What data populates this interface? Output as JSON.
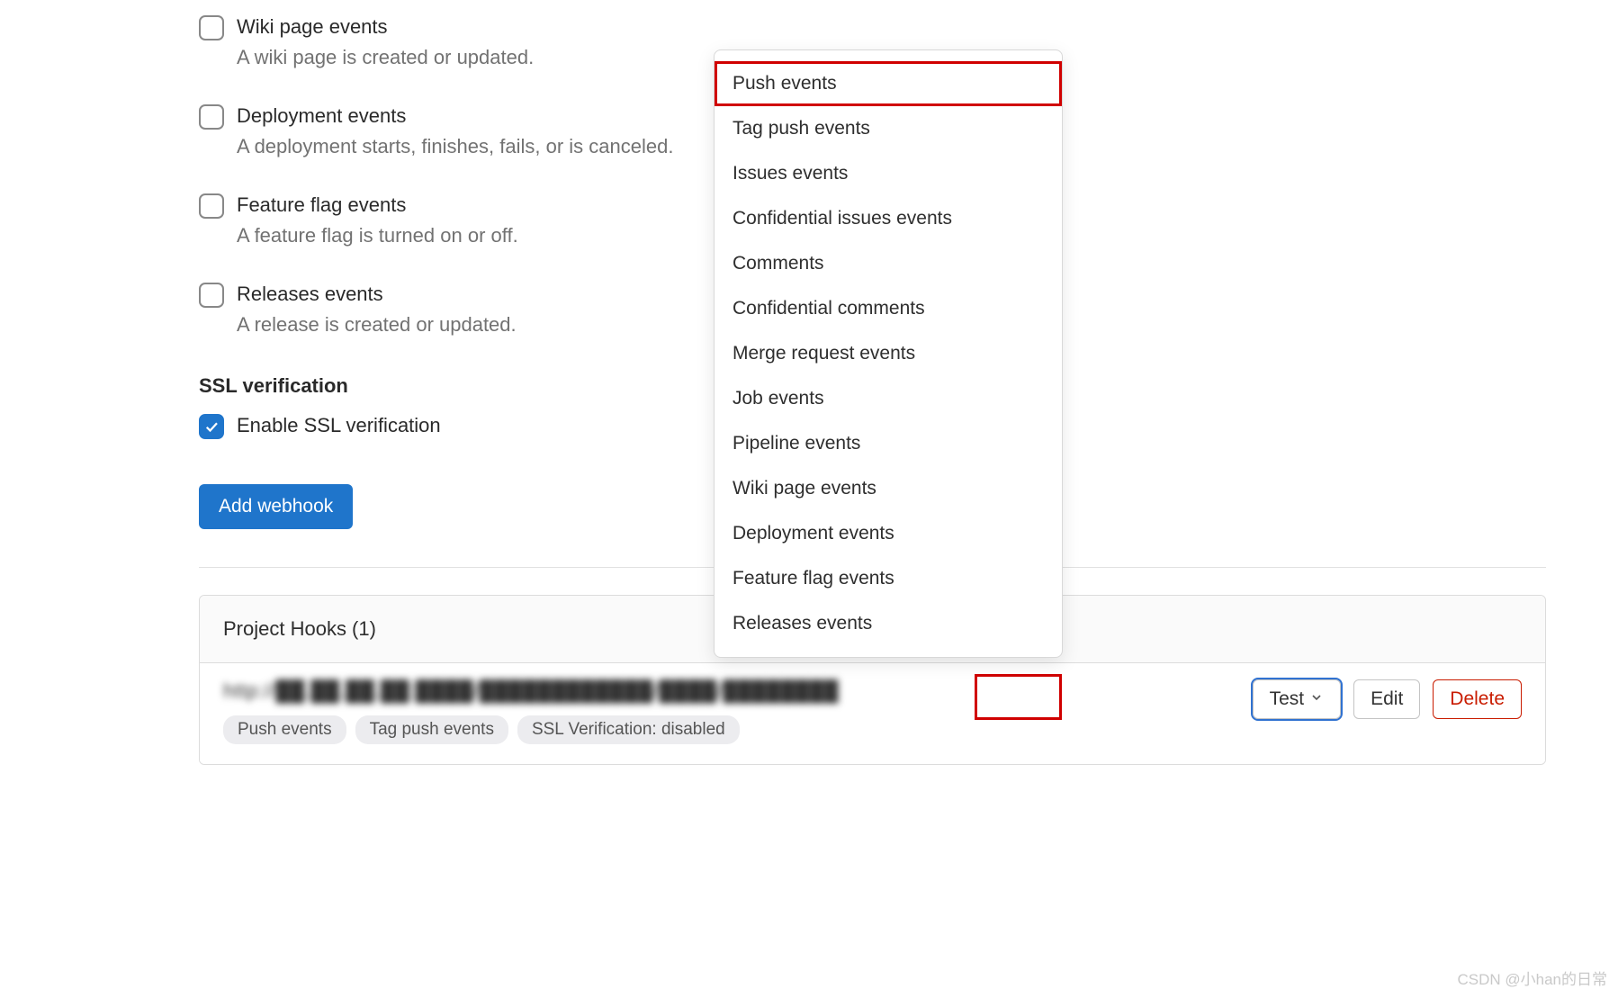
{
  "triggers": [
    {
      "label": "Wiki page events",
      "desc": "A wiki page is created or updated."
    },
    {
      "label": "Deployment events",
      "desc": "A deployment starts, finishes, fails, or is canceled."
    },
    {
      "label": "Feature flag events",
      "desc": "A feature flag is turned on or off."
    },
    {
      "label": "Releases events",
      "desc": "A release is created or updated."
    }
  ],
  "ssl": {
    "heading": "SSL verification",
    "label": "Enable SSL verification",
    "checked": true
  },
  "addButton": "Add webhook",
  "hooksPanel": {
    "title": "Project Hooks (1)",
    "url": "http://██.██.██.██:████/████████████/████/████████",
    "badges": [
      "Push events",
      "Tag push events",
      "SSL Verification: disabled"
    ],
    "actions": {
      "test": "Test",
      "edit": "Edit",
      "delete": "Delete"
    }
  },
  "dropdown": [
    "Push events",
    "Tag push events",
    "Issues events",
    "Confidential issues events",
    "Comments",
    "Confidential comments",
    "Merge request events",
    "Job events",
    "Pipeline events",
    "Wiki page events",
    "Deployment events",
    "Feature flag events",
    "Releases events"
  ],
  "watermark": "CSDN @小han的日常"
}
